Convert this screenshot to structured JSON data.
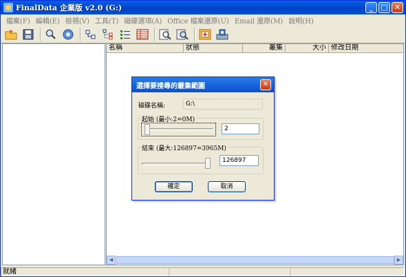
{
  "window": {
    "title": "FinalData 企業版 v2.0 (G:)"
  },
  "title_buttons": {
    "minimize": "_",
    "maximize": "□",
    "close": "✕"
  },
  "menu": [
    "檔案(F)",
    "編輯(E)",
    "檢視(V)",
    "工具(T)",
    "磁碟選項(A)",
    "Office 檔案還原(U)",
    "Email 還原(M)",
    "說明(H)"
  ],
  "toolbar": {
    "icons": [
      "open-folder-icon",
      "save-disk-icon",
      "search-magnifier-icon",
      "settings-gear-icon",
      "tree-small-icon",
      "tree-branch-icon",
      "tree-list-icon",
      "details-list-icon",
      "find-icon",
      "find-advanced-icon",
      "window-add-icon",
      "disk-image-icon"
    ]
  },
  "list": {
    "columns": [
      "名稱",
      "狀態",
      "叢集",
      "大小",
      "修改日期"
    ]
  },
  "status": {
    "text": "就緒"
  },
  "dialog": {
    "title": "選擇要搜尋的叢集範圍",
    "disk_label": "磁碟名稱:",
    "disk_value": "G:\\",
    "start_group": "起始 (最小:2=0M)",
    "start_value": "2",
    "start_level": 0.0,
    "end_group": "結束 (最大:126897=3965M)",
    "end_value": "126897",
    "end_level": 1.0,
    "ok": "確定",
    "cancel": "取消"
  },
  "colors": {
    "titlebar": "#0a4fd8",
    "face": "#ece9d8",
    "window_border": "#0831d9"
  }
}
